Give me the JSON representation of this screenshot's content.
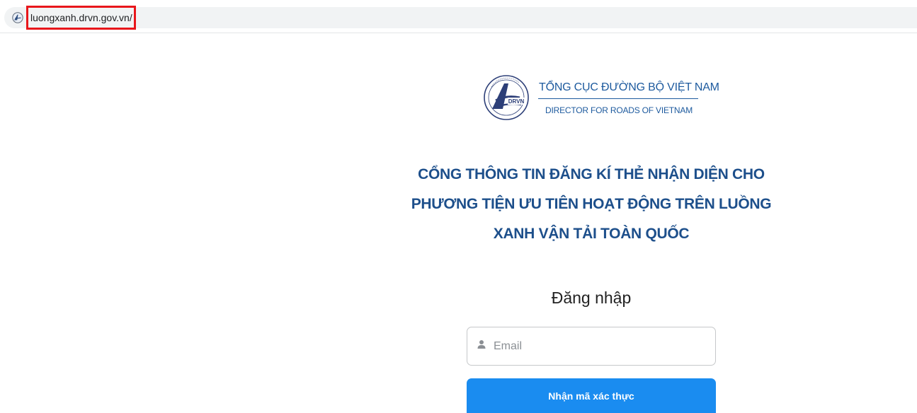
{
  "browser": {
    "url": "luongxanh.drvn.gov.vn/",
    "site_icon": "drvn-favicon-icon"
  },
  "header": {
    "logo": "drvn-logo",
    "org_name_vi": "TỔNG CỤC ĐƯỜNG BỘ VIỆT NAM",
    "org_name_en": "DIRECTOR FOR ROADS OF VIETNAM"
  },
  "main": {
    "title_lines": [
      "CỔNG THÔNG TIN ĐĂNG KÍ THẺ NHẬN DIỆN CHO",
      "PHƯƠNG TIỆN ƯU TIÊN HOẠT ĐỘNG TRÊN LUỒNG",
      "XANH VẬN TẢI TOÀN QUỐC"
    ]
  },
  "login": {
    "heading": "Đăng nhập",
    "email_placeholder": "Email",
    "email_value": "",
    "email_icon": "user-icon",
    "submit_label": "Nhận mã xác thực"
  },
  "colors": {
    "brand_blue": "#1d5a9e",
    "title_blue": "#1d4f8b",
    "button_blue": "#1a8cf0",
    "highlight_red": "#e8161b"
  }
}
